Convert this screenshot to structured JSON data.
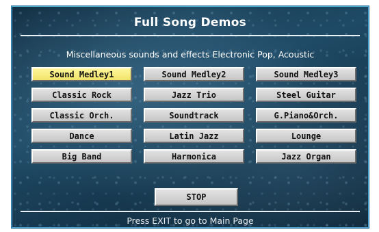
{
  "header": {
    "title": "Full Song Demos"
  },
  "subtitle": "Miscellaneous sounds and effects  Electronic Pop, Acoustic",
  "demos": [
    {
      "label": "Sound Medley1",
      "selected": true
    },
    {
      "label": "Sound Medley2",
      "selected": false
    },
    {
      "label": "Sound Medley3",
      "selected": false
    },
    {
      "label": "Classic Rock",
      "selected": false
    },
    {
      "label": "Jazz Trio",
      "selected": false
    },
    {
      "label": "Steel Guitar",
      "selected": false
    },
    {
      "label": "Classic Orch.",
      "selected": false
    },
    {
      "label": "Soundtrack",
      "selected": false
    },
    {
      "label": "G.Piano&Orch.",
      "selected": false
    },
    {
      "label": "Dance",
      "selected": false
    },
    {
      "label": "Latin Jazz",
      "selected": false
    },
    {
      "label": "Lounge",
      "selected": false
    },
    {
      "label": "Big Band",
      "selected": false
    },
    {
      "label": "Harmonica",
      "selected": false
    },
    {
      "label": "Jazz Organ",
      "selected": false
    }
  ],
  "stop_label": "STOP",
  "footer": "Press EXIT to go to Main Page",
  "colors": {
    "selected_button": "#f5e97a",
    "button": "#d4d4d4",
    "frame": "#4fa9d6"
  }
}
